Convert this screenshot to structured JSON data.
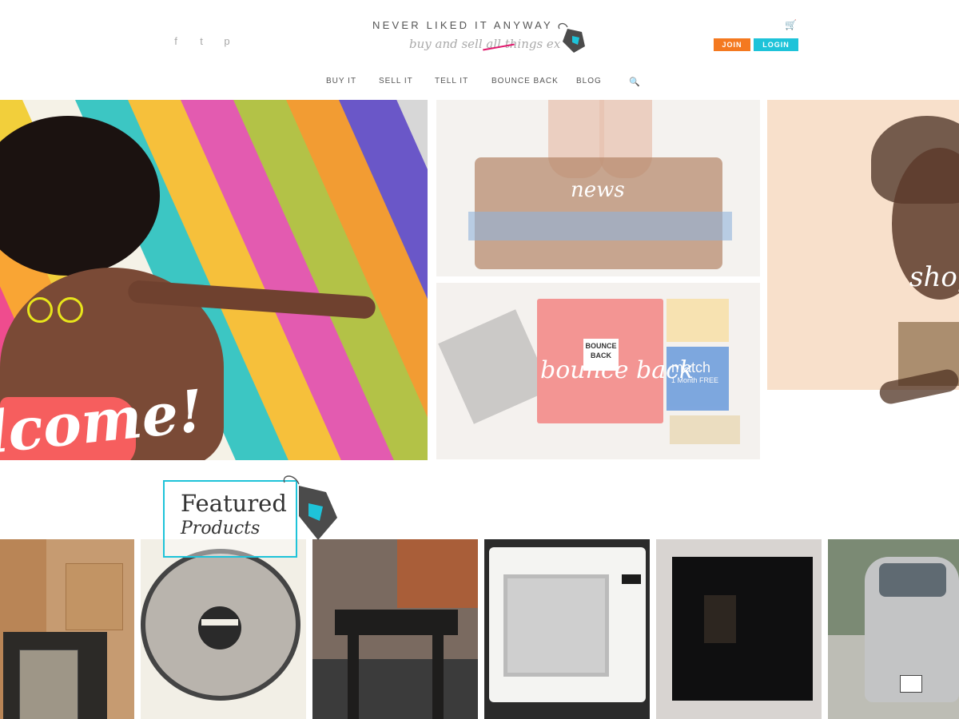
{
  "header": {
    "social_icons": [
      "facebook-icon",
      "twitter-icon",
      "pinterest-icon"
    ],
    "logo_title": "NEVER LIKED IT ANYWAY",
    "logo_tagline": "buy and sell all things ex",
    "cart_icon": "cart-icon",
    "join_label": "JOIN",
    "login_label": "LOGIN",
    "join_color": "#f47920",
    "login_color": "#1ec3d9"
  },
  "nav": {
    "items": [
      "BUY IT",
      "SELL IT",
      "TELL IT",
      "BOUNCE BACK",
      "BLOG"
    ],
    "search_icon": "search-icon"
  },
  "tiles": {
    "welcome": "lcome!",
    "news": "news",
    "bounce": "bounce back",
    "shop": "shop",
    "box_label": "BOUNCE BACK",
    "match_label": "match",
    "match_sub": "1 Month FREE"
  },
  "featured": {
    "line1": "Featured",
    "line2": "Products"
  },
  "products": [
    {
      "name": "table-item"
    },
    {
      "name": "fan"
    },
    {
      "name": "side-table"
    },
    {
      "name": "microwave"
    },
    {
      "name": "television"
    },
    {
      "name": "car"
    }
  ]
}
